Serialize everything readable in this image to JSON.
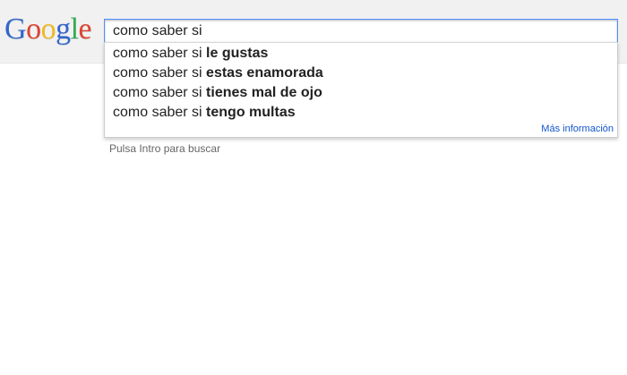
{
  "logo": {
    "letters": [
      {
        "char": "G",
        "color": "#3366cc"
      },
      {
        "char": "o",
        "color": "#dd4433"
      },
      {
        "char": "o",
        "color": "#eebb22"
      },
      {
        "char": "g",
        "color": "#3366cc"
      },
      {
        "char": "l",
        "color": "#33aa55"
      },
      {
        "char": "e",
        "color": "#dd4433"
      }
    ]
  },
  "search": {
    "value": "como saber si"
  },
  "suggestions": [
    {
      "prefix": "como saber si ",
      "completion": "le gustas"
    },
    {
      "prefix": "como saber si ",
      "completion": "estas enamorada"
    },
    {
      "prefix": "como saber si ",
      "completion": "tienes mal de ojo"
    },
    {
      "prefix": "como saber si ",
      "completion": "tengo multas"
    }
  ],
  "more_info_label": "Más información",
  "hint_text": "Pulsa Intro para buscar",
  "colors": {
    "accent_border": "#4d90fe",
    "link": "#1155cc",
    "header_bg": "#f1f1f1"
  }
}
